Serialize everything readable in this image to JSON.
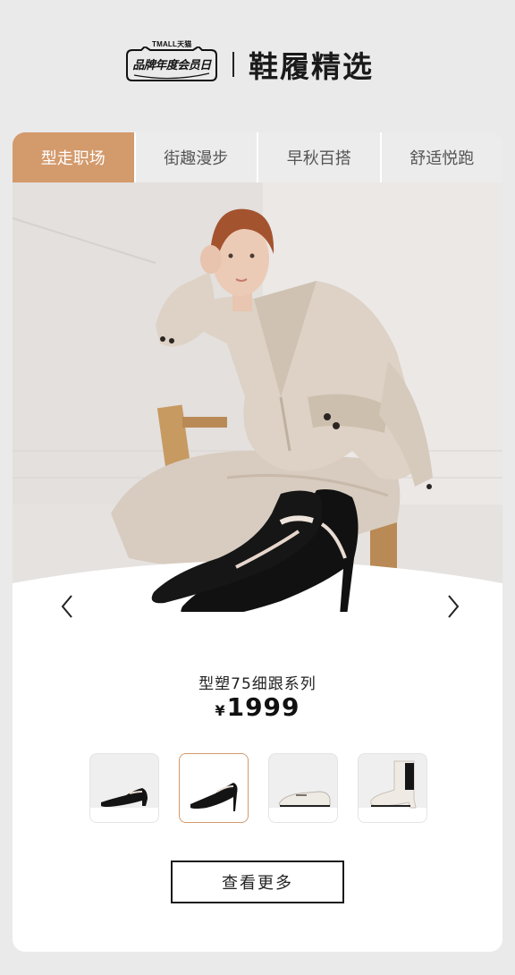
{
  "header": {
    "logo_brand": "TMALL天猫",
    "logo_text": "品牌年度会员日",
    "title": "鞋履精选"
  },
  "tabs": [
    {
      "label": "型走职场",
      "active": true
    },
    {
      "label": "街趣漫步",
      "active": false
    },
    {
      "label": "早秋百搭",
      "active": false
    },
    {
      "label": "舒适悦跑",
      "active": false
    }
  ],
  "product": {
    "name": "型塑75细跟系列",
    "currency": "¥",
    "price": "1999"
  },
  "thumbnails": [
    {
      "name": "black-block-heel-pump",
      "selected": false
    },
    {
      "name": "black-stiletto-pump",
      "selected": true
    },
    {
      "name": "white-loafer",
      "selected": false
    },
    {
      "name": "white-chelsea-boot",
      "selected": false
    }
  ],
  "actions": {
    "more_label": "查看更多"
  },
  "colors": {
    "accent": "#d39a6c",
    "background": "#eaeaea",
    "card": "#ffffff"
  }
}
